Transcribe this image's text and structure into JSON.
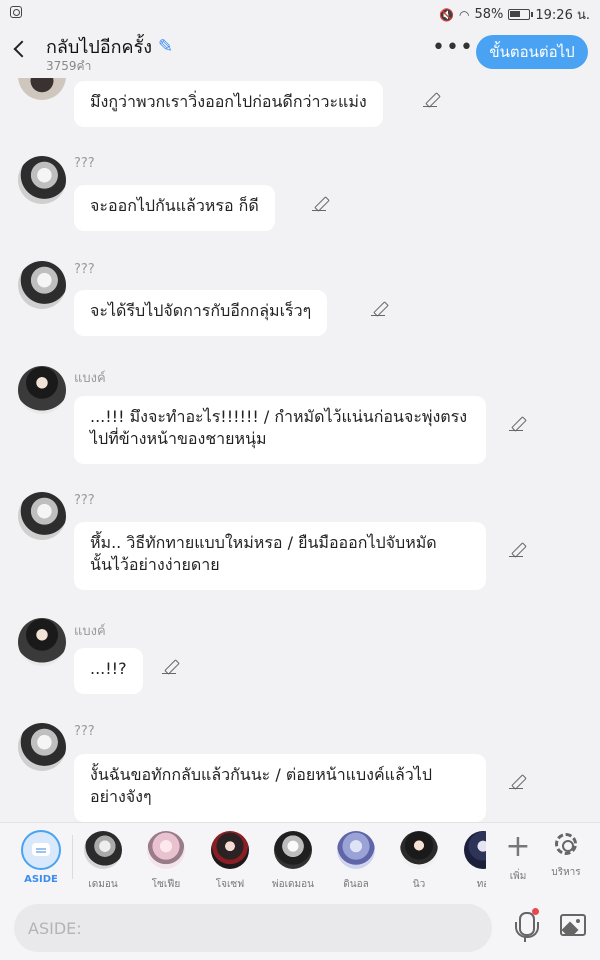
{
  "status_bar": {
    "battery": "58%",
    "time": "19:26 น."
  },
  "header": {
    "title": "กลับไปอีกครั้ง",
    "word_count": "3759คำ",
    "more_label": "•••",
    "next_button": "ขั้นตอนต่อไป"
  },
  "messages": [
    {
      "sender": "",
      "text": "มึงกูว่าพวกเราวิ่งออกไปก่อนดีกว่าวะแม่ง",
      "avatar": "top"
    },
    {
      "sender": "???",
      "text": "จะออกไปกันแล้วหรอ ก็ดี",
      "avatar": "white"
    },
    {
      "sender": "???",
      "text": "จะได้รีบไปจัดการกับอีกกลุ่มเร็วๆ",
      "avatar": "white"
    },
    {
      "sender": "แบงค์",
      "text": "...!!! มึงจะทำอะไร!!!!!! / กำหมัดไว้แน่นก่อนจะพุ่งตรง\nไปที่ข้างหน้าของชายหนุ่ม",
      "avatar": "dark"
    },
    {
      "sender": "???",
      "text": "หึ้ม.. วิธีทักทายแบบใหม่หรอ / ยืนมือออกไปจับหมัด\nนั้นไว้อย่างง่ายดาย",
      "avatar": "white"
    },
    {
      "sender": "แบงค์",
      "text": "...!!?",
      "avatar": "dark"
    },
    {
      "sender": "???",
      "text": "งั้นฉันขอทักกลับแล้วกันนะ / ต่อยหน้าแบงค์แล้วไป\nอย่างจังๆ",
      "avatar": "white"
    }
  ],
  "character_bar": {
    "aside_label": "ASIDE",
    "characters": [
      {
        "label": "เดมอน"
      },
      {
        "label": "โซเฟีย"
      },
      {
        "label": "โจเซฟ"
      },
      {
        "label": "พ่อเดมอน"
      },
      {
        "label": "ดินอล"
      },
      {
        "label": "นิว"
      },
      {
        "label": "ทอ"
      }
    ],
    "add_label": "เพิ่ม",
    "manage_label": "บริหาร"
  },
  "input_bar": {
    "placeholder": "ASIDE:"
  }
}
